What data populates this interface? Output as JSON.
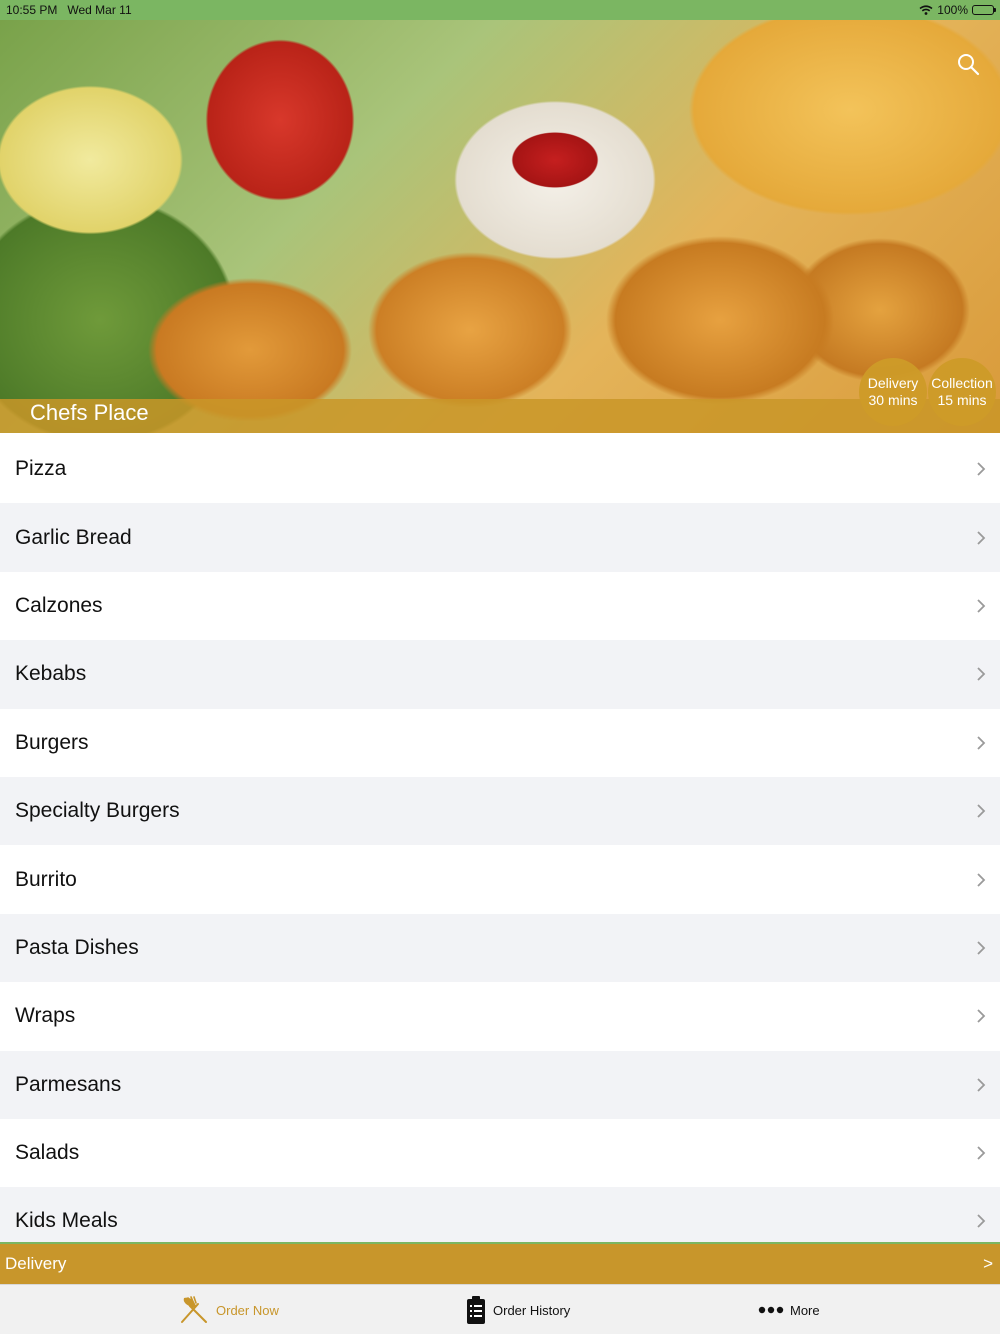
{
  "status_bar": {
    "time": "10:55 PM",
    "date": "Wed Mar 11",
    "battery": "100%"
  },
  "hero": {
    "store_name": "Chefs Place",
    "delivery_label": "Delivery",
    "delivery_time": "30 mins",
    "collection_label": "Collection",
    "collection_time": "15 mins"
  },
  "menu": {
    "categories": [
      "Pizza",
      "Garlic Bread",
      "Calzones",
      "Kebabs",
      "Burgers",
      "Specialty Burgers",
      "Burrito",
      "Pasta Dishes",
      "Wraps",
      "Parmesans",
      "Salads",
      "Kids Meals"
    ]
  },
  "delivery_bar": {
    "label": "Delivery",
    "arrow": ">"
  },
  "tabs": {
    "order_now": "Order Now",
    "order_history": "Order History",
    "more": "More"
  },
  "colors": {
    "accent": "#c8962b",
    "status_bar": "#7bb662"
  },
  "icons": {
    "search": "search-icon",
    "order_now": "fork-knife-icon",
    "order_history": "clipboard-icon",
    "more": "dots-icon",
    "chevron": "chevron-right-icon"
  }
}
